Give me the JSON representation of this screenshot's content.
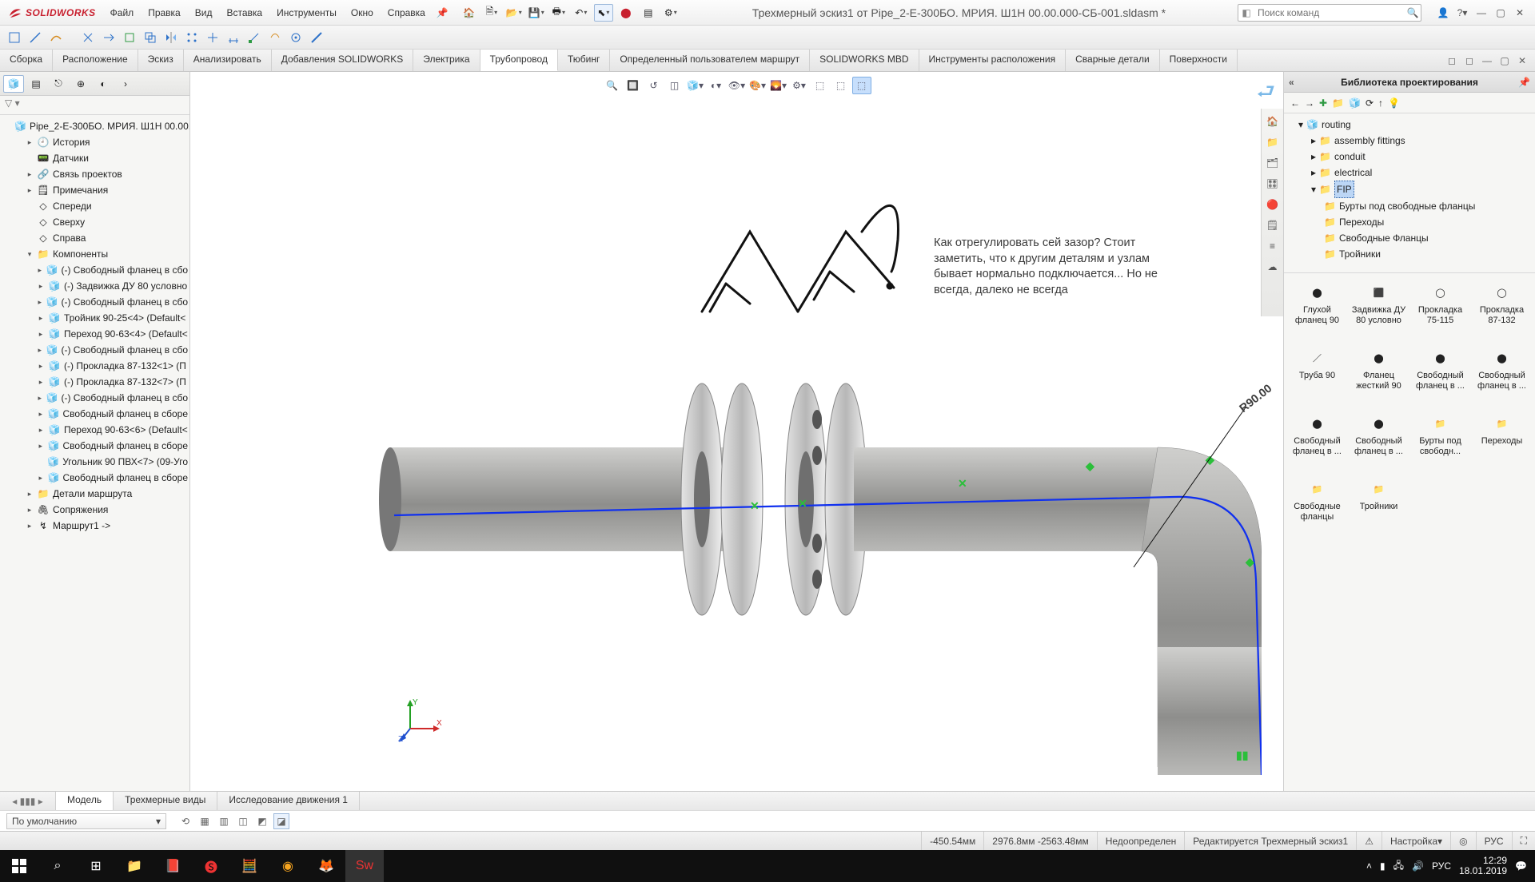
{
  "app": {
    "brand": "SOLIDWORKS"
  },
  "menu": [
    "Файл",
    "Правка",
    "Вид",
    "Вставка",
    "Инструменты",
    "Окно",
    "Справка"
  ],
  "doc_title": "Трехмерный эскиз1 от Pipe_2-Е-300БО. МРИЯ. Ш1Н 00.00.000-СБ-001.sldasm *",
  "search_placeholder": "Поиск команд",
  "ribbon_tabs": [
    "Сборка",
    "Расположение",
    "Эскиз",
    "Анализировать",
    "Добавления SOLIDWORKS",
    "Электрика",
    "Трубопровод",
    "Тюбинг",
    "Определенный пользователем маршрут",
    "SOLIDWORKS MBD",
    "Инструменты расположения",
    "Сварные детали",
    "Поверхности"
  ],
  "ribbon_active": 6,
  "tree_root": "Pipe_2-Е-300БО. МРИЯ. Ш1Н 00.00.",
  "tree_top": [
    "История",
    "Датчики",
    "Связь проектов",
    "Примечания",
    "Спереди",
    "Сверху",
    "Справа"
  ],
  "tree_components_label": "Компоненты",
  "tree_components": [
    "(-) Свободный фланец в сбо",
    "(-) Задвижка ДУ 80 условно",
    "(-) Свободный фланец в сбо",
    "Тройник 90-25<4> (Default<",
    "Переход 90-63<4> (Default<",
    "(-) Свободный фланец в сбо",
    "(-) Прокладка 87-132<1> (П",
    "(-) Прокладка 87-132<7> (П",
    "(-) Свободный фланец в сбо",
    "Свободный фланец в сборе",
    "Переход 90-63<6> (Default<",
    "Свободный фланец в сборе",
    "Угольник 90 ПВХ<7> (09-Уго",
    "Свободный фланец в сборе"
  ],
  "tree_tail": [
    "Детали маршрута",
    "Сопряжения",
    "Маршрут1 ->"
  ],
  "annotation_text": "Как отрегулировать сей зазор? Стоит заметить, что к другим деталям и узлам бывает нормально подключается... Но не всегда, далеко не всегда",
  "dim_label": "R90.00",
  "right": {
    "title": "Библиотека проектирования",
    "tree_root": "routing",
    "tree_items": [
      "assembly fittings",
      "conduit",
      "electrical"
    ],
    "tree_sel": "FIP",
    "tree_sub": [
      "Бурты под свободные фланцы",
      "Переходы",
      "Свободные Фланцы",
      "Тройники"
    ],
    "grid": [
      "Глухой фланец 90",
      "Задвижка ДУ 80 условно",
      "Прокладка 75-115",
      "Прокладка 87-132",
      "Труба 90",
      "Фланец жесткий 90",
      "Свободный фланец в ...",
      "Свободный фланец в ...",
      "Свободный фланец в ...",
      "Свободный фланец в ...",
      "Бурты под свободн...",
      "Переходы",
      "Свободные фланцы",
      "Тройники"
    ]
  },
  "bottom_tabs": [
    "Модель",
    "Трехмерные виды",
    "Исследование движения 1"
  ],
  "config_name": "По умолчанию",
  "status": {
    "coord1": "-450.54мм",
    "coord2": "2976.8мм -2563.48мм",
    "defined": "Недоопределен",
    "editing": "Редактируется Трехмерный эскиз1",
    "custom": "Настройка",
    "lang": "РУС"
  },
  "taskbar": {
    "time": "12:29",
    "date": "18.01.2019",
    "lang": "РУС"
  }
}
